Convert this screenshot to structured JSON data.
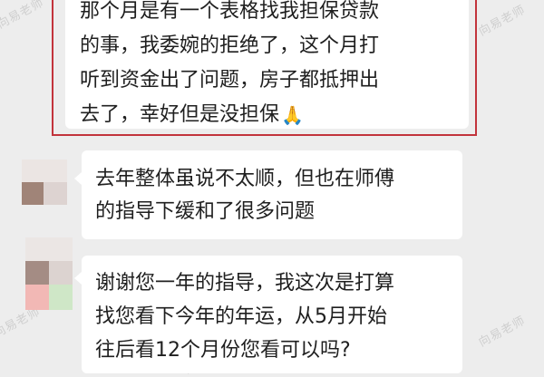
{
  "messages": {
    "highlighted": {
      "lines": [
        "那个月是有一个表格找我担保贷款",
        "的事，我委婉的拒绝了，这个月打",
        "听到资金出了问题，房子都抵押出",
        "去了，幸好但是没担保"
      ],
      "emoji": "🙏"
    },
    "second": {
      "lines": [
        "去年整体虽说不太顺，但也在师傅",
        "的指导下缓和了很多问题"
      ]
    },
    "third": {
      "lines": [
        "谢谢您一年的指导，我这次是打算",
        "找您看下今年的年运，从5月开始",
        "往后看12个月份您看可以吗?"
      ]
    }
  },
  "watermarks": [
    "向易老师",
    "向易老师",
    "向易老师",
    "向易老师",
    "向易老师",
    "向易老师"
  ],
  "colors": {
    "background": "#ededed",
    "bubble": "#ffffff",
    "highlight_border": "#c2343c",
    "text": "#1f1f1f"
  }
}
